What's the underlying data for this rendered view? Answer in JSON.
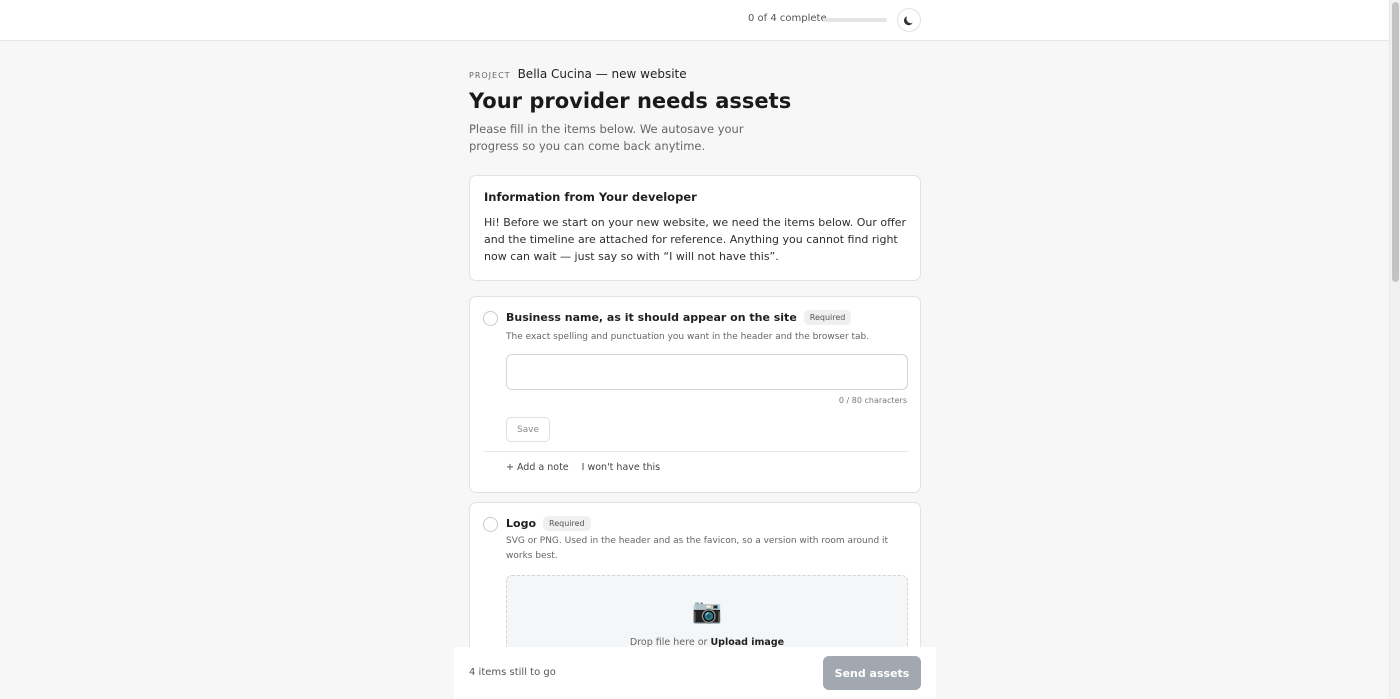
{
  "topbar": {
    "progress_text": "0 of 4 complete",
    "progress_fraction": 0,
    "theme_icon": "moon-icon"
  },
  "header": {
    "project_label": "PROJECT",
    "project_name": "Bella Cucina — new website",
    "title": "Your provider needs assets",
    "subtitle": "Please fill in the items below. We autosave your progress so you can come back anytime."
  },
  "info": {
    "title": "Information from Your developer",
    "body": "Hi! Before we start on your new website, we need the items below. Our offer and the timeline are attached for reference. Anything you cannot find right now can wait — just say so with “I will not have this”."
  },
  "items": [
    {
      "title": "Business name, as it should appear on the site",
      "badge": "Required",
      "description": "The exact spelling and punctuation you want in the header and the browser tab.",
      "input_value": "",
      "char_count": "0 / 80 characters",
      "save_label": "Save",
      "add_note_label": "+  Add a note",
      "wont_have_label": "I won't have this"
    },
    {
      "title": "Logo",
      "badge": "Required",
      "description": "SVG or PNG. Used in the header and as the favicon, so a version with room around it works best.",
      "drop_text": "Drop file here or",
      "upload_label": "Upload image",
      "icon": "camera-icon"
    }
  ],
  "footer": {
    "remaining": "4 items still to go",
    "send_label": "Send assets"
  }
}
